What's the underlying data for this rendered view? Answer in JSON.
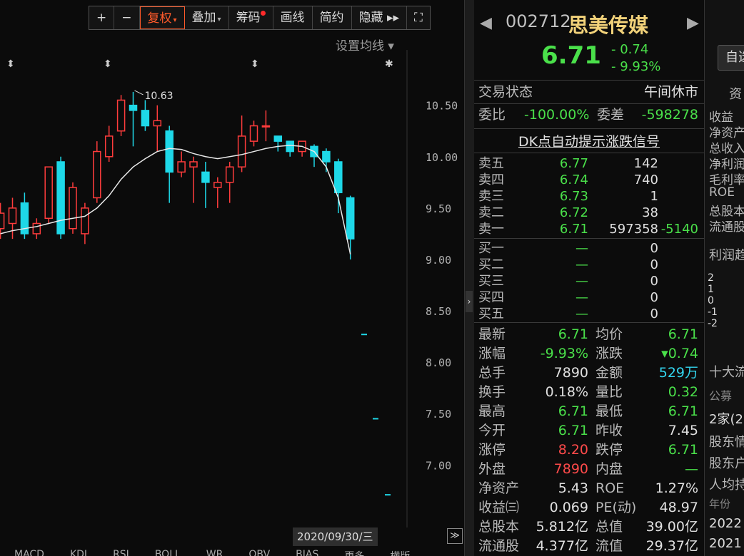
{
  "toolbar": {
    "plus": "+",
    "minus": "−",
    "fuquan": "复权",
    "diejia": "叠加",
    "chouma": "筹码",
    "huaxian": "画线",
    "jianyue": "简约",
    "yincang": "隐藏 ▸▸",
    "fullscreen": "⛶"
  },
  "avg_line_label": "设置均线 ▾",
  "date_label": "2020/09/30/三",
  "expand_label": "≫",
  "indicator_tabs": [
    "MACD",
    "KDJ",
    "RSI",
    "BOLL",
    "WR",
    "OBV",
    "BIAS",
    "更多",
    "横版"
  ],
  "chart_data": {
    "type": "candlestick",
    "ylim": [
      6.6,
      10.9
    ],
    "y_ticks": [
      "10.50",
      "10.00",
      "9.50",
      "9.00",
      "8.50",
      "8.00",
      "7.50",
      "7.00"
    ],
    "y_tick_values": [
      10.5,
      10.0,
      9.5,
      9.0,
      8.5,
      8.0,
      7.5,
      7.0
    ],
    "max_label": "10.63",
    "candles": [
      {
        "o": 9.3,
        "h": 9.55,
        "l": 9.2,
        "c": 9.45
      },
      {
        "o": 9.35,
        "h": 9.6,
        "l": 9.2,
        "c": 9.5
      },
      {
        "o": 9.55,
        "h": 9.65,
        "l": 9.2,
        "c": 9.25
      },
      {
        "o": 9.25,
        "h": 9.4,
        "l": 9.2,
        "c": 9.35
      },
      {
        "o": 9.4,
        "h": 9.9,
        "l": 9.35,
        "c": 9.9
      },
      {
        "o": 9.95,
        "h": 10.0,
        "l": 9.2,
        "c": 9.25
      },
      {
        "o": 9.3,
        "h": 9.75,
        "l": 9.25,
        "c": 9.7
      },
      {
        "o": 9.25,
        "h": 9.55,
        "l": 9.15,
        "c": 9.5
      },
      {
        "o": 9.6,
        "h": 10.15,
        "l": 9.55,
        "c": 10.05
      },
      {
        "o": 10.0,
        "h": 10.3,
        "l": 9.95,
        "c": 10.2
      },
      {
        "o": 10.25,
        "h": 10.6,
        "l": 10.2,
        "c": 10.55
      },
      {
        "o": 10.5,
        "h": 10.63,
        "l": 10.1,
        "c": 10.45
      },
      {
        "o": 10.45,
        "h": 10.55,
        "l": 10.25,
        "c": 10.3
      },
      {
        "o": 10.3,
        "h": 10.5,
        "l": 10.05,
        "c": 10.35
      },
      {
        "o": 10.25,
        "h": 10.3,
        "l": 9.55,
        "c": 9.85
      },
      {
        "o": 9.85,
        "h": 10.05,
        "l": 9.8,
        "c": 9.95
      },
      {
        "o": 9.9,
        "h": 10.0,
        "l": 9.55,
        "c": 9.95
      },
      {
        "o": 9.85,
        "h": 9.95,
        "l": 9.5,
        "c": 9.75
      },
      {
        "o": 9.7,
        "h": 9.8,
        "l": 9.5,
        "c": 9.75
      },
      {
        "o": 9.75,
        "h": 9.95,
        "l": 9.55,
        "c": 9.9
      },
      {
        "o": 9.9,
        "h": 10.4,
        "l": 9.85,
        "c": 10.2
      },
      {
        "o": 10.15,
        "h": 10.35,
        "l": 10.1,
        "c": 10.3
      },
      {
        "o": 10.3,
        "h": 10.45,
        "l": 10.15,
        "c": 10.3
      },
      {
        "o": 10.2,
        "h": 10.2,
        "l": 10.05,
        "c": 10.15
      },
      {
        "o": 10.15,
        "h": 10.15,
        "l": 10.0,
        "c": 10.05
      },
      {
        "o": 10.05,
        "h": 10.15,
        "l": 10.0,
        "c": 10.15
      },
      {
        "o": 10.1,
        "h": 10.12,
        "l": 9.9,
        "c": 10.0
      },
      {
        "o": 10.05,
        "h": 10.08,
        "l": 9.85,
        "c": 9.95
      },
      {
        "o": 9.95,
        "h": 9.98,
        "l": 9.45,
        "c": 9.65
      },
      {
        "o": 9.6,
        "h": 9.62,
        "l": 9.0,
        "c": 9.2
      }
    ],
    "ma": [
      9.25,
      9.28,
      9.3,
      9.32,
      9.35,
      9.38,
      9.4,
      9.42,
      9.5,
      9.62,
      9.78,
      9.9,
      9.98,
      10.05,
      10.08,
      10.07,
      10.03,
      10.0,
      9.98,
      10.0,
      10.02,
      10.05,
      10.08,
      10.1,
      10.11,
      10.1,
      10.05,
      9.9,
      9.6,
      9.05
    ],
    "limit_marks": [
      8.27,
      7.45,
      6.71
    ]
  },
  "quote": {
    "code": "002712",
    "name": "思美传媒",
    "price": "6.71",
    "change": "- 0.74",
    "change_pct": "- 9.93%",
    "status_label": "交易状态",
    "status_value": "午间休市",
    "webi_label": "委比",
    "webi_value": "-100.00%",
    "weicha_label": "委差",
    "weicha_value": "-598278",
    "signal": "DK点自动提示涨跌信号",
    "sells": [
      {
        "label": "卖五",
        "price": "6.77",
        "vol": "142",
        "chg": ""
      },
      {
        "label": "卖四",
        "price": "6.74",
        "vol": "740",
        "chg": ""
      },
      {
        "label": "卖三",
        "price": "6.73",
        "vol": "1",
        "chg": ""
      },
      {
        "label": "卖二",
        "price": "6.72",
        "vol": "38",
        "chg": ""
      },
      {
        "label": "卖一",
        "price": "6.71",
        "vol": "597358",
        "chg": "-5140"
      }
    ],
    "buys": [
      {
        "label": "买一",
        "price": "—",
        "vol": "0"
      },
      {
        "label": "买二",
        "price": "—",
        "vol": "0"
      },
      {
        "label": "买三",
        "price": "—",
        "vol": "0"
      },
      {
        "label": "买四",
        "price": "—",
        "vol": "0"
      },
      {
        "label": "买五",
        "price": "—",
        "vol": "0"
      }
    ],
    "stats": [
      {
        "l1": "最新",
        "v1": "6.71",
        "c1": "g",
        "l2": "均价",
        "v2": "6.71",
        "c2": "g"
      },
      {
        "l1": "涨幅",
        "v1": "-9.93%",
        "c1": "g",
        "l2": "涨跌",
        "v2": "▾0.74",
        "c2": "g"
      },
      {
        "l1": "总手",
        "v1": "7890",
        "c1": "w",
        "l2": "金额",
        "v2": "529万",
        "c2": "c"
      },
      {
        "l1": "换手",
        "v1": "0.18%",
        "c1": "w",
        "l2": "量比",
        "v2": "0.32",
        "c2": "g"
      },
      {
        "l1": "最高",
        "v1": "6.71",
        "c1": "g",
        "l2": "最低",
        "v2": "6.71",
        "c2": "g"
      },
      {
        "l1": "今开",
        "v1": "6.71",
        "c1": "g",
        "l2": "昨收",
        "v2": "7.45",
        "c2": "w"
      },
      {
        "l1": "涨停",
        "v1": "8.20",
        "c1": "r",
        "l2": "跌停",
        "v2": "6.71",
        "c2": "g"
      },
      {
        "l1": "外盘",
        "v1": "7890",
        "c1": "r",
        "l2": "内盘",
        "v2": "—",
        "c2": "g"
      },
      {
        "l1": "净资产",
        "v1": "5.43",
        "c1": "w",
        "l2": "ROE",
        "v2": "1.27%",
        "c2": "w"
      },
      {
        "l1": "收益㈢",
        "v1": "0.069",
        "c1": "w",
        "l2": "PE(动)",
        "v2": "48.97",
        "c2": "w"
      },
      {
        "l1": "总股本",
        "v1": "5.812亿",
        "c1": "w",
        "l2": "总值",
        "v2": "39.00亿",
        "c2": "w"
      },
      {
        "l1": "流通股",
        "v1": "4.377亿",
        "c1": "w",
        "l2": "流值",
        "v2": "29.37亿",
        "c2": "w"
      }
    ]
  },
  "side": {
    "button": "自选",
    "tab": "资",
    "lines": [
      "收益",
      "净资产",
      "总收入",
      "净利润",
      "毛利率",
      "ROE",
      "总股本",
      "流通股"
    ],
    "profit_trend": "利润趋",
    "axis": [
      "2",
      "1",
      "0",
      "-1",
      "-2"
    ],
    "top10": "十大流",
    "gongmu": "公募",
    "jia": "2家(2",
    "holder1": "股东情",
    "holder2": "股东户",
    "avg": "人均持",
    "year_label": "年份",
    "y2022": "2022",
    "y2021": "2021"
  }
}
